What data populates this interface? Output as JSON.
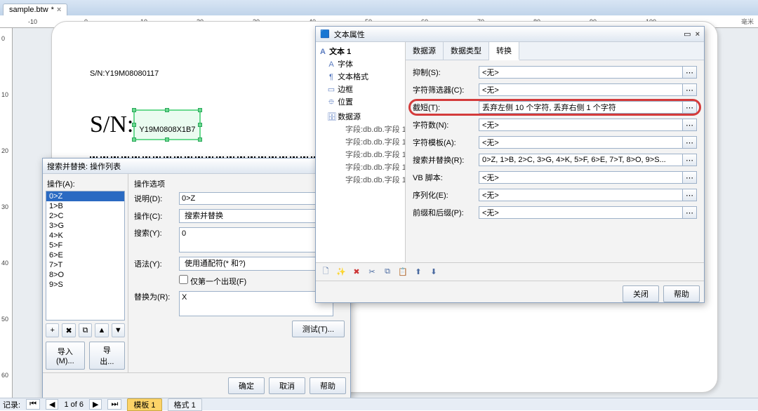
{
  "tab": {
    "filename": "sample.btw",
    "dirty": "*"
  },
  "ruler": {
    "unit": "毫米",
    "marks": [
      -10,
      0,
      10,
      20,
      30,
      40,
      50,
      60,
      70,
      80,
      90,
      100
    ]
  },
  "label": {
    "sn1_prefix": "S/N:",
    "sn1": "Y19M08080117",
    "sn2_prefix": "S/N:",
    "sn2": "Y19M0808X1B7"
  },
  "find_dialog": {
    "title": "搜索并替换: 操作列表",
    "ops_label": "操作(A):",
    "list": [
      "0>Z",
      "1>B",
      "2>C",
      "3>G",
      "4>K",
      "5>F",
      "6>E",
      "7>T",
      "8>O",
      "9>S"
    ],
    "opts_title": "操作选项",
    "desc_label": "说明(D):",
    "desc_value": "0>Z",
    "op_label": "操作(C):",
    "op_value": "搜索并替换",
    "search_label": "搜索(Y):",
    "search_value": "0",
    "syntax_label": "语法(Y):",
    "syntax_value": "使用通配符(* 和?)",
    "first_only": "仅第一个出现(F)",
    "replace_label": "替换为(R):",
    "replace_value": "X",
    "import_btn": "导入(M)...",
    "export_btn": "导出...",
    "test_btn": "测试(T)...",
    "ok": "确定",
    "cancel": "取消",
    "help": "帮助"
  },
  "props_dialog": {
    "title": "文本属性",
    "tree": {
      "root": "文本 1",
      "nodes": [
        "字体",
        "文本格式",
        "边框",
        "位置",
        "数据源"
      ],
      "data_children": [
        "字段:db.db.字段 1",
        "字段:db.db.字段 1",
        "字段:db.db.字段 1",
        "字段:db.db.字段 1",
        "字段:db.db.字段 1"
      ]
    },
    "tabs": [
      "数据源",
      "数据类型",
      "转换"
    ],
    "rows": {
      "suppress": {
        "label": "抑制(S):",
        "value": "<无>"
      },
      "filter": {
        "label": "字符筛选器(C):",
        "value": "<无>"
      },
      "truncate": {
        "label": "截短(T):",
        "value": "丢弃左侧 10 个字符, 丢弃右侧 1 个字符"
      },
      "count": {
        "label": "字符数(N):",
        "value": "<无>"
      },
      "template": {
        "label": "字符模板(A):",
        "value": "<无>"
      },
      "search": {
        "label": "搜索并替换(R):",
        "value": "0>Z, 1>B, 2>C, 3>G, 4>K, 5>F, 6>E, 7>T, 8>O, 9>S..."
      },
      "vb": {
        "label": "VB 脚本:",
        "value": "<无>"
      },
      "serial": {
        "label": "序列化(E):",
        "value": "<无>"
      },
      "prefix": {
        "label": "前缀和后缀(P):",
        "value": "<无>"
      }
    },
    "close": "关闭",
    "help": "帮助"
  },
  "status": {
    "record_label": "记录:",
    "record_nav": "1 of 6",
    "template_tab": "模板 1",
    "format_tab": "格式 1"
  }
}
